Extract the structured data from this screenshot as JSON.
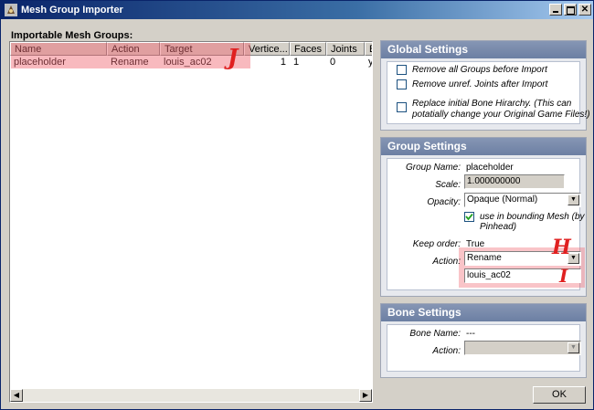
{
  "window": {
    "title": "Mesh Group Importer"
  },
  "list": {
    "label": "Importable Mesh Groups:",
    "columns": [
      "Name",
      "Action",
      "Target",
      "Vertice...",
      "Faces",
      "Joints",
      "B"
    ],
    "rows": [
      {
        "name": "placeholder",
        "action": "Rename",
        "target": "louis_ac02",
        "vertices": "1",
        "faces": "1",
        "joints": "0",
        "b": "y"
      }
    ]
  },
  "global_settings": {
    "title": "Global Settings",
    "remove_groups": "Remove all Groups before Import",
    "remove_joints": "Remove unref. Joints after Import",
    "replace_bone_line1": "Replace initial Bone  Hirarchy. (This can",
    "replace_bone_line2": "potatially change your Original Game Files!)"
  },
  "group_settings": {
    "title": "Group Settings",
    "group_name_label": "Group Name:",
    "group_name_value": "placeholder",
    "scale_label": "Scale:",
    "scale_value": "1.000000000",
    "opacity_label": "Opacity:",
    "opacity_value": "Opaque (Normal)",
    "bounding_line1": "use in bounding Mesh (by",
    "bounding_line2": "Pinhead)",
    "keep_order_label": "Keep order:",
    "keep_order_value": "True",
    "action_label": "Action:",
    "action_value": "Rename",
    "target_value": "louis_ac02"
  },
  "bone_settings": {
    "title": "Bone Settings",
    "bone_name_label": "Bone Name:",
    "bone_name_value": "---",
    "action_label": "Action:"
  },
  "ok_label": "OK",
  "annotations": {
    "mark_j": "J",
    "mark_h": "H",
    "mark_i": "I"
  }
}
